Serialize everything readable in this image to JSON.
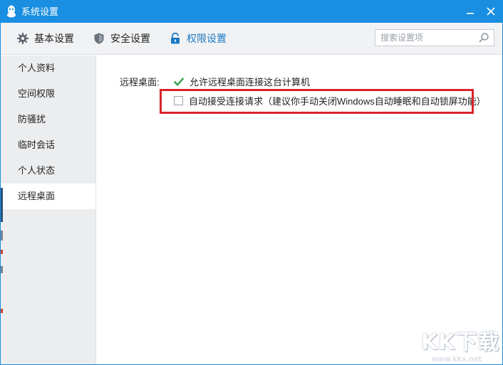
{
  "window": {
    "title": "系统设置"
  },
  "tabs": [
    {
      "label": "基本设置",
      "icon": "gear-icon"
    },
    {
      "label": "安全设置",
      "icon": "shield-icon"
    },
    {
      "label": "权限设置",
      "icon": "lock-icon",
      "active": true
    }
  ],
  "search": {
    "placeholder": "搜索设置项",
    "value": ""
  },
  "sidebar": {
    "items": [
      {
        "label": "个人资料"
      },
      {
        "label": "空间权限"
      },
      {
        "label": "防骚扰"
      },
      {
        "label": "临时会话"
      },
      {
        "label": "个人状态"
      },
      {
        "label": "远程桌面",
        "active": true
      }
    ]
  },
  "remote_desktop": {
    "label": "远程桌面:",
    "options": [
      {
        "label": "允许远程桌面连接这台计算机",
        "checked": true
      },
      {
        "label": "自动接受连接请求（建议你手动关闭Windows自动睡眠和自动锁屏功能）",
        "checked": false
      }
    ]
  },
  "watermark": {
    "logo": "KK下载",
    "url": "www.kkx.net"
  },
  "colors": {
    "titlebar": "#1a8ee1",
    "accent": "#1a79c4",
    "check_green": "#3aa757",
    "highlight_red": "#d9252a"
  }
}
